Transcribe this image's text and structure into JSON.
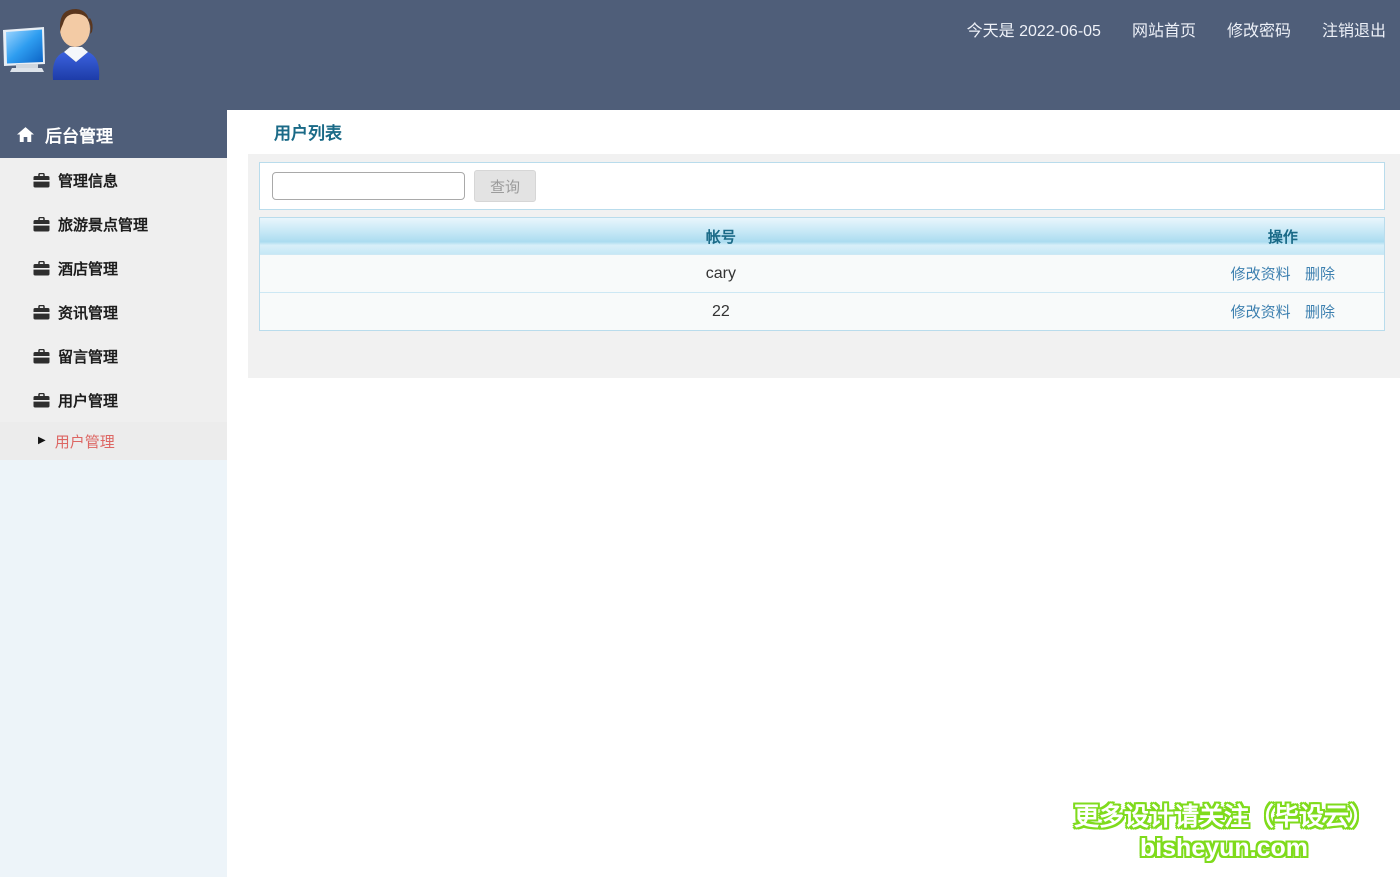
{
  "header": {
    "date_text": "今天是 2022-06-05",
    "nav": [
      {
        "label": "网站首页"
      },
      {
        "label": "修改密码"
      },
      {
        "label": "注销退出"
      }
    ]
  },
  "sidebar": {
    "title": "后台管理",
    "items": [
      {
        "label": "管理信息",
        "icon": "briefcase-icon"
      },
      {
        "label": "旅游景点管理",
        "icon": "briefcase-icon"
      },
      {
        "label": "酒店管理",
        "icon": "briefcase-icon"
      },
      {
        "label": "资讯管理",
        "icon": "briefcase-icon"
      },
      {
        "label": "留言管理",
        "icon": "briefcase-icon"
      },
      {
        "label": "用户管理",
        "icon": "briefcase-icon"
      }
    ],
    "subitems": [
      {
        "label": "用户管理",
        "icon": "triangle-right-icon"
      }
    ],
    "header_icon": "home-icon"
  },
  "main": {
    "page_title": "用户列表",
    "search": {
      "input_value": "",
      "button_label": "查询"
    },
    "table": {
      "columns": [
        "帐号",
        "操作"
      ],
      "rows": [
        {
          "account": "cary",
          "actions": [
            "修改资料",
            "删除"
          ]
        },
        {
          "account": "22",
          "actions": [
            "修改资料",
            "删除"
          ]
        }
      ]
    }
  },
  "watermark": {
    "line1": "更多设计请关注（毕设云）",
    "line2": "bisheyun.com"
  },
  "colors": {
    "header_bg": "#4f5e79",
    "title_text": "#1a6a87",
    "table_header_blue": "#abdcf0",
    "link_blue": "#3d80b0",
    "submenu_red": "#dd6663",
    "watermark_green": "#7fdb1c"
  }
}
